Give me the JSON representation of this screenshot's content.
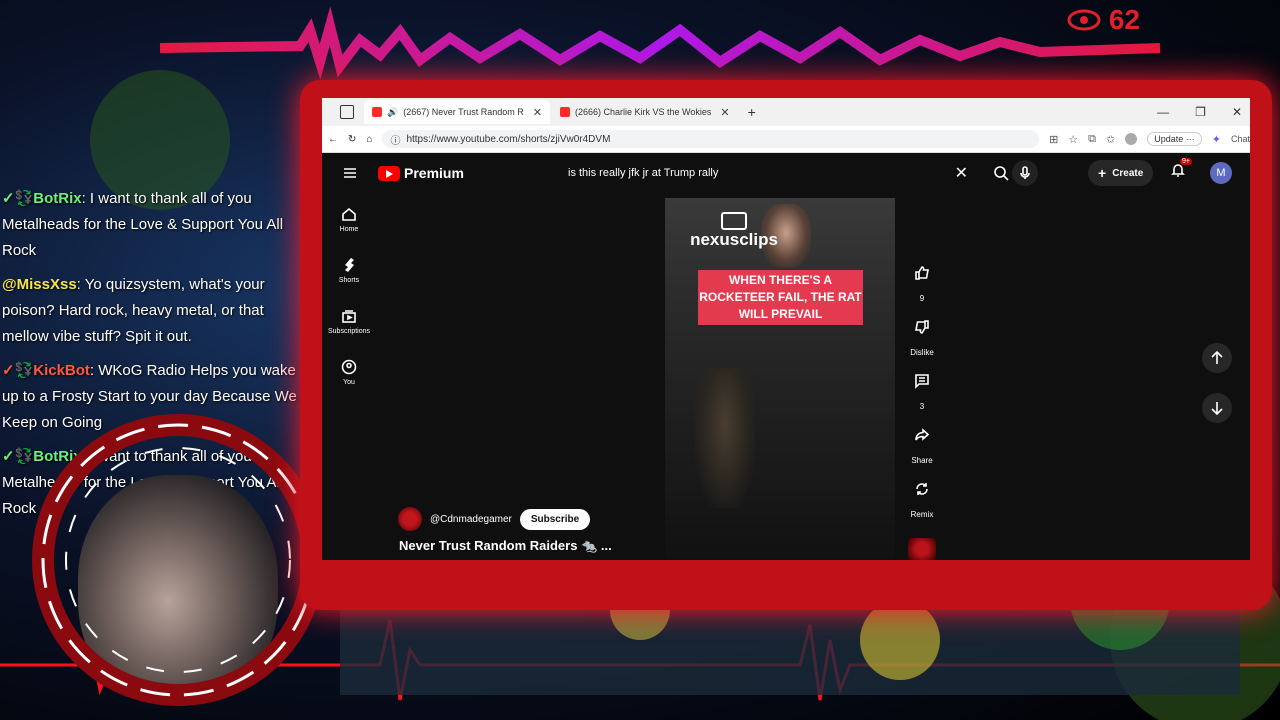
{
  "overlay": {
    "viewer_count": "62",
    "colors": {
      "accent_red": "#e0202a",
      "frame_red": "#c01018"
    }
  },
  "chat": [
    {
      "user": "✓💱BotRix",
      "text": ": I want to thank all of you Metalheads for the Love & Support You All Rock"
    },
    {
      "user": "@MissXss",
      "text": ": Yo quizsystem, what's your poison? Hard rock, heavy metal, or that mellow vibe stuff? Spit it out."
    },
    {
      "user": "✓💱KickBot",
      "text": ": WKoG Radio Helps you wake up to a Frosty Start to your day Because We Keep on Going"
    },
    {
      "user": "✓💱BotRix",
      "text": ": I want to thank all of you Metalheads for the Love & Support You All Rock"
    }
  ],
  "browser": {
    "tabs": [
      {
        "label": "(2667) Never Trust Random R",
        "active": true
      },
      {
        "label": "(2666) Charlie Kirk VS the Wokies",
        "active": false
      }
    ],
    "new_tab": "+",
    "url": "https://www.youtube.com/shorts/zjiVw0r4DVM",
    "update_label": "Update",
    "chat_label": "Chat"
  },
  "youtube": {
    "logo_text": "Premium",
    "search_value": "is this really jfk jr at Trump rally",
    "create_label": "Create",
    "notification_badge": "9+",
    "avatar_letter": "M",
    "sidebar": [
      {
        "label": "Home",
        "icon": "home-icon"
      },
      {
        "label": "Shorts",
        "icon": "shorts-icon"
      },
      {
        "label": "Subscriptions",
        "icon": "subscriptions-icon"
      },
      {
        "label": "You",
        "icon": "you-icon"
      }
    ],
    "short": {
      "watermark": "nexusclips",
      "caption": "WHEN THERE'S A ROCKETEER FAIL, THE RAT WILL PREVAIL",
      "channel": "@Cdnmadegamer",
      "subscribe_label": "Subscribe",
      "title": "Never Trust Random Raiders 🐀 ..."
    },
    "actions": {
      "likes": "9",
      "dislike_label": "Dislike",
      "comments": "3",
      "share_label": "Share",
      "remix_label": "Remix"
    }
  }
}
